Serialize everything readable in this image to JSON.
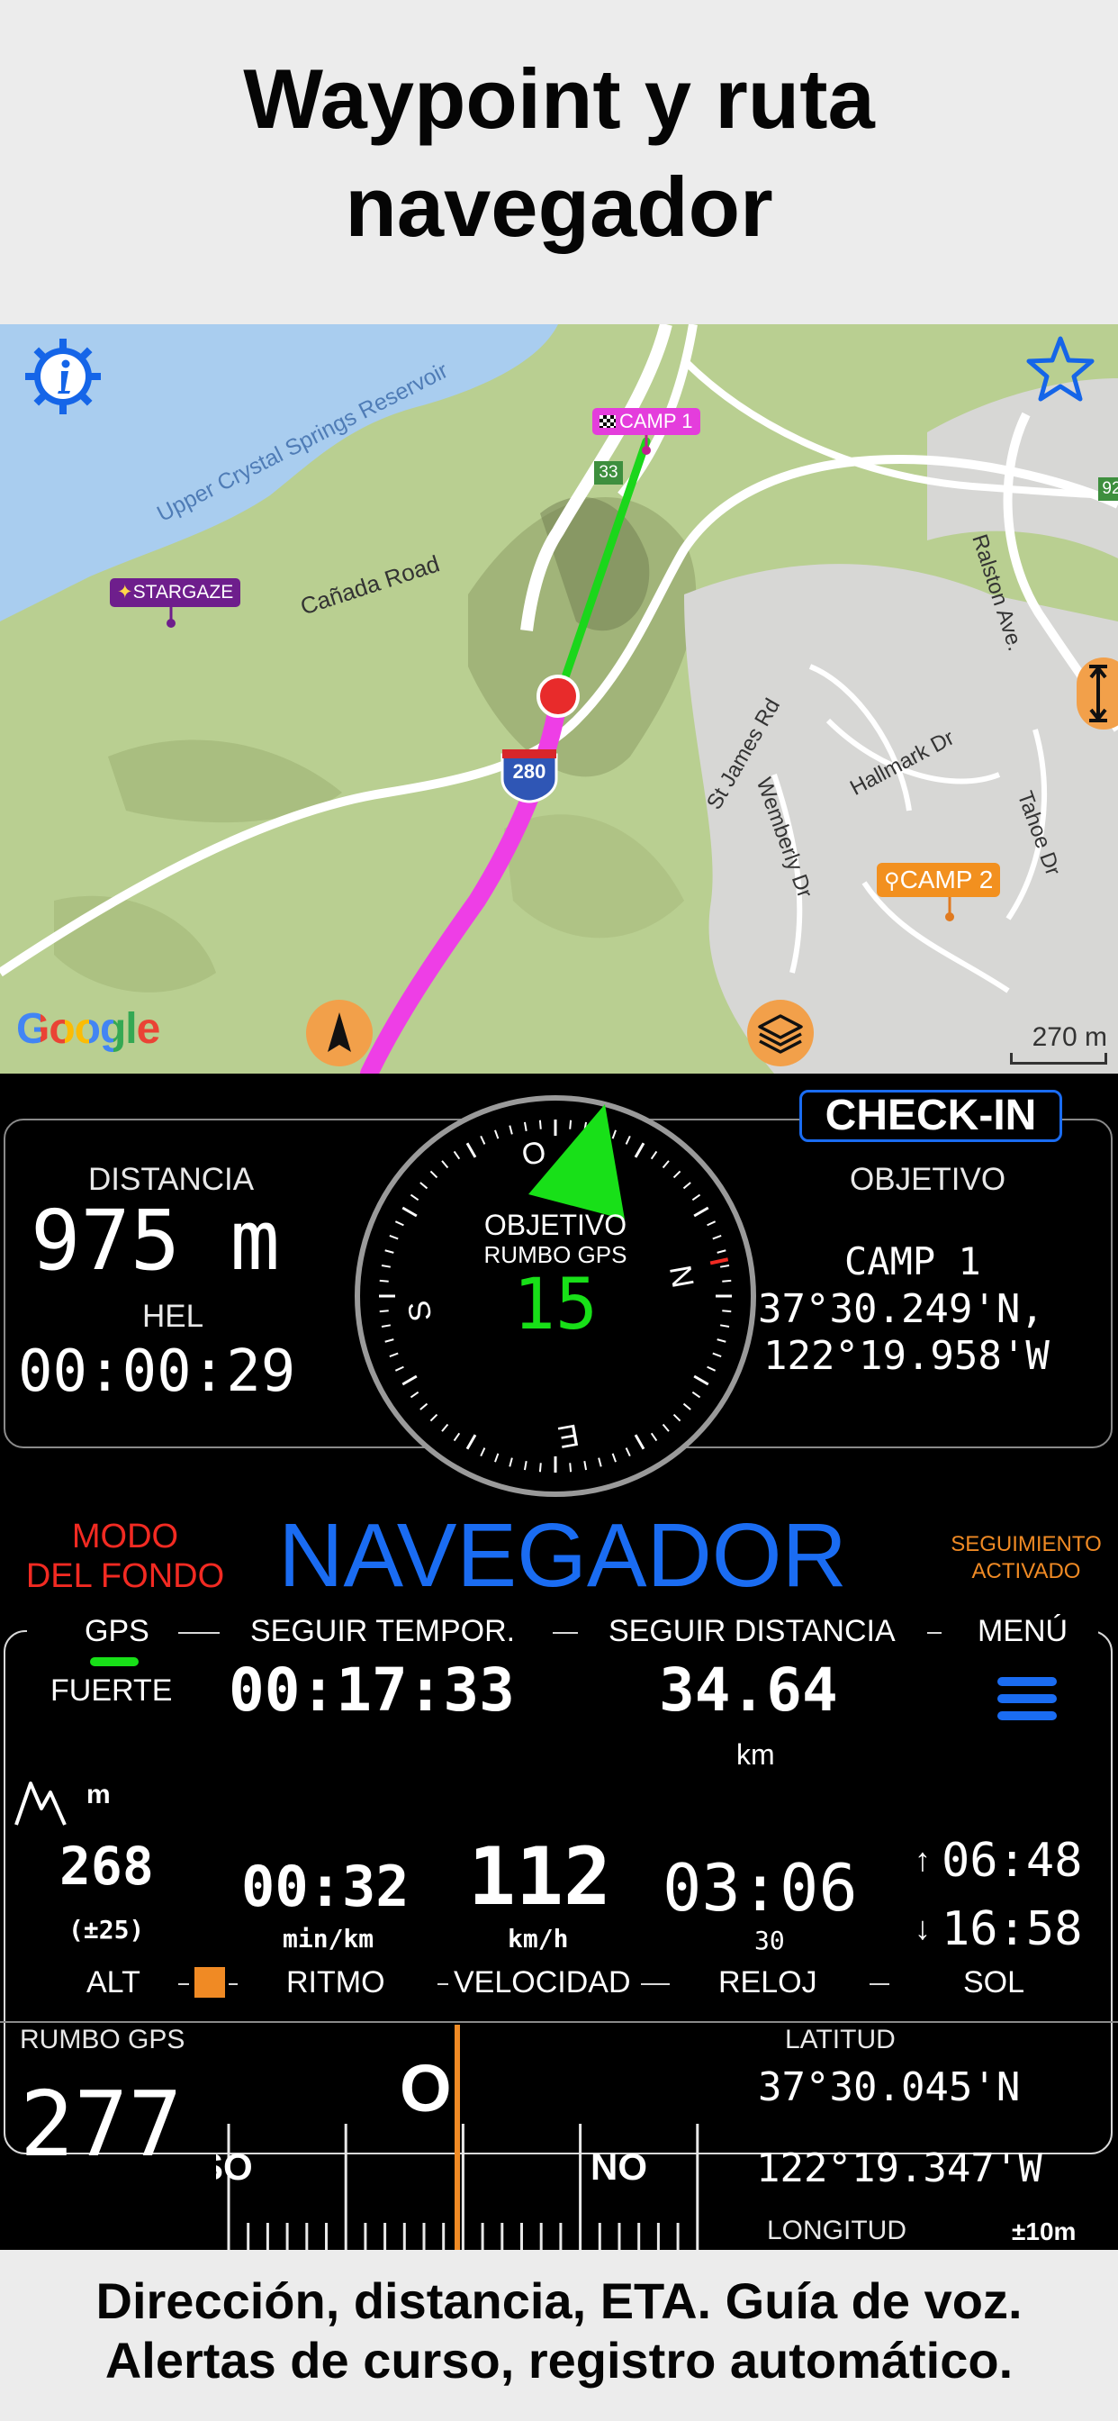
{
  "promo": {
    "headline_line1": "Waypoint y ruta",
    "headline_line2": "navegador",
    "footer_line1": "Dirección, distancia, ETA. Guía de voz.",
    "footer_line2": "Alertas de curso, registro automático."
  },
  "map": {
    "labels": {
      "reservoir": "Upper Crystal Springs Reservoir",
      "canada_road": "Cañada Road",
      "ralston": "Ralston Ave.",
      "st_james": "St James Rd",
      "hallmark": "Hallmark Dr",
      "wemberly": "Wemberly Dr",
      "tahoe": "Tahoe Dr",
      "route_33": "33",
      "route_92": "92",
      "interstate_280": "280"
    },
    "waypoints": {
      "camp1": "CAMP 1",
      "camp2": "CAMP 2",
      "stargaze": "STARGAZE"
    },
    "google_logo": "Google",
    "scale": "270 m",
    "icons": {
      "info": "info-gear-icon",
      "favorite": "star-icon",
      "resize": "vertical-resize-icon",
      "north": "north-arrow-icon",
      "layers": "layers-icon"
    },
    "colors": {
      "route_to_target": "#1bd61b",
      "track": "#ee3ee6",
      "water": "#a9cdef",
      "icon_blue": "#1565e8",
      "icon_orange": "#f2a04a"
    }
  },
  "navigator": {
    "check_in": "CHECK-IN",
    "distance_label": "DISTANCIA",
    "distance_value": "975 m",
    "hel_label": "HEL",
    "hel_value": "00:00:29",
    "target_label": "OBJETIVO",
    "target_name": "CAMP 1",
    "target_lat": "37°30.249'N,",
    "target_lon": "122°19.958'W",
    "compass": {
      "center_label1": "OBJETIVO",
      "center_label2": "RUMBO GPS",
      "center_value": "15",
      "north_letter": "N",
      "south_letter": "S",
      "east_letter": "E",
      "west_letter": "O"
    },
    "background_mode_line1": "MODO",
    "background_mode_line2": "DEL FONDO",
    "title": "NAVEGADOR",
    "tracking_line1": "SEGUIMIENTO",
    "tracking_line2": "ACTIVADO",
    "tabs": {
      "gps": "GPS",
      "follow_time": "SEGUIR TEMPOR.",
      "follow_distance": "SEGUIR DISTANCIA",
      "menu": "MENÚ"
    },
    "gps_strength": "FUERTE",
    "follow_time_value": "00:17:33",
    "follow_distance_value": "34.64",
    "follow_distance_unit": "km",
    "alt_unit": "m",
    "alt_value": "268",
    "alt_accuracy": "(±25)",
    "pace_value": "00:32",
    "pace_unit": "min/km",
    "speed_value": "112",
    "speed_unit": "km/h",
    "clock_value": "03:06",
    "clock_seconds": "30",
    "sunrise": "06:48",
    "sunset": "16:58",
    "bottom_labels": {
      "alt": "ALT",
      "pace": "RITMO",
      "speed": "VELOCIDAD",
      "clock": "RELOJ",
      "sun": "SOL"
    },
    "heading_label": "RUMBO GPS",
    "heading_value": "277",
    "tape": {
      "big_letter": "O",
      "left_letter": "SO",
      "right_letter": "NO"
    },
    "latitude_label": "LATITUD",
    "latitude_value": "37°30.045'N",
    "longitude_value": "122°19.347'W",
    "longitude_label": "LONGITUD",
    "accuracy": "±10m",
    "colors": {
      "accent_blue": "#1a6cf2",
      "red": "#f22a22",
      "orange": "#f08a24",
      "green": "#18e018"
    }
  }
}
